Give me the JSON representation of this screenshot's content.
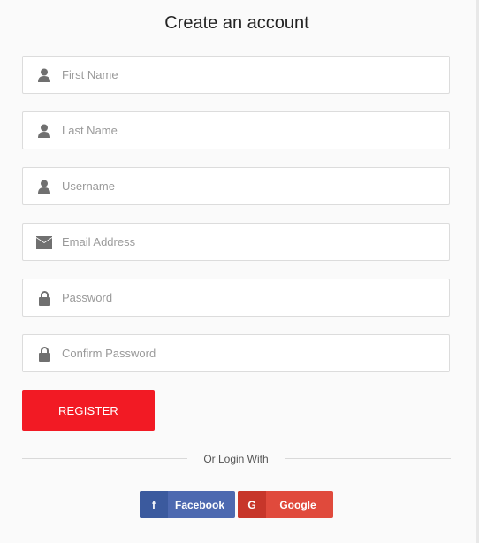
{
  "form": {
    "title": "Create an account",
    "fields": [
      {
        "placeholder": "First Name",
        "value": "",
        "icon": "user-icon"
      },
      {
        "placeholder": "Last Name",
        "value": "",
        "icon": "user-icon"
      },
      {
        "placeholder": "Username",
        "value": "",
        "icon": "user-icon"
      },
      {
        "placeholder": "Email Address",
        "value": "",
        "icon": "envelope-icon"
      },
      {
        "placeholder": "Password",
        "value": "",
        "icon": "lock-icon"
      },
      {
        "placeholder": "Confirm Password",
        "value": "",
        "icon": "lock-icon"
      }
    ],
    "register_label": "REGISTER",
    "divider_text": "Or Login With"
  },
  "social": {
    "facebook": {
      "label": "Facebook",
      "icon_glyph": "f",
      "color": "#4d69b0"
    },
    "google": {
      "label": "Google",
      "icon_glyph": "G",
      "color": "#e04a3c"
    }
  },
  "colors": {
    "register": "#f21a24",
    "icon": "#707070"
  }
}
